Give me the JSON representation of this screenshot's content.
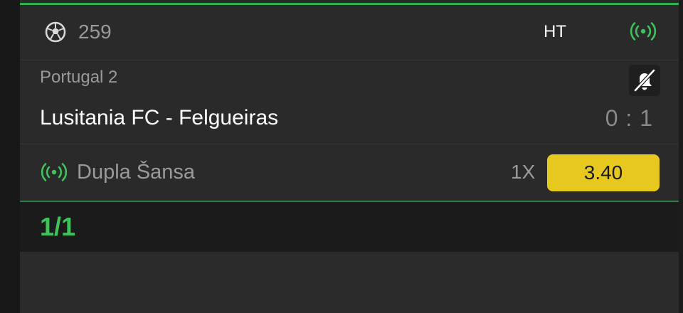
{
  "header": {
    "match_code": "259",
    "period": "HT",
    "sport_icon": "soccer-ball-icon",
    "live_icon": "live-broadcast-icon"
  },
  "match": {
    "league": "Portugal 2",
    "teams": "Lusitania FC - Felgueiras",
    "score": "0 : 1",
    "bell_icon": "bell-off-icon"
  },
  "bet": {
    "market": "Dupla Šansa",
    "selection": "1X",
    "odds": "3.40",
    "live_icon": "live-broadcast-icon"
  },
  "summary": {
    "count": "1/1"
  },
  "colors": {
    "accent_green": "#2bb24c",
    "live_green": "#3fc35c",
    "odds_yellow": "#e6c81e",
    "card_bg": "#2a2a2a"
  }
}
